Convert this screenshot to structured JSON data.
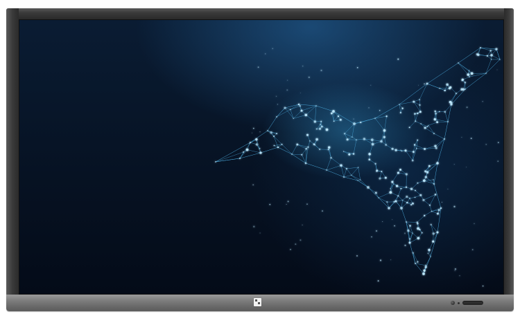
{
  "screen": {
    "wallpaper": "low-poly-hummingbird-constellation",
    "colors": {
      "background_dark": "#040b18",
      "background_glow": "#2a6ea8",
      "line": "#4fb4e8",
      "node": "#bfeaff"
    }
  },
  "bezel": {
    "color": "#3a3a3a",
    "bar_color": "#7e7e7e"
  },
  "controls": {
    "logo_icon": "brand-logo-icon",
    "power_icon": "power-button-icon",
    "sensor_icon": "ir-sensor-icon",
    "port_icon": "usb-port-icon"
  }
}
